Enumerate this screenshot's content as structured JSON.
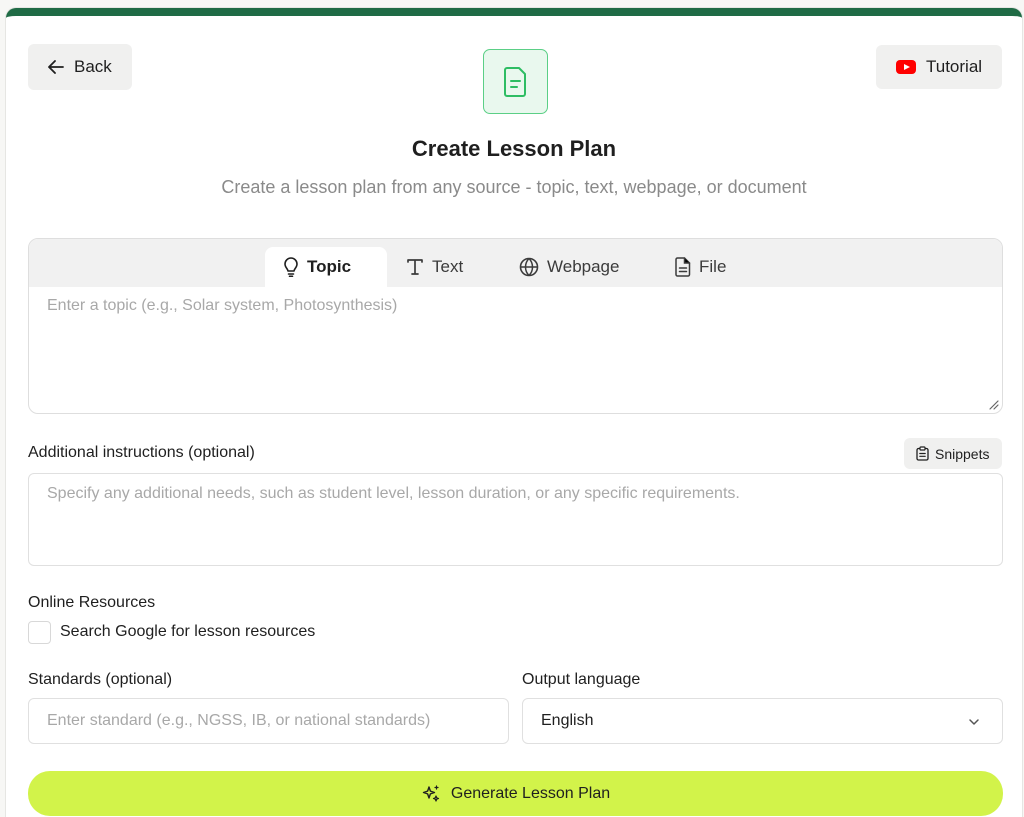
{
  "header": {
    "back_label": "Back",
    "tutorial_label": "Tutorial",
    "title": "Create Lesson Plan",
    "subtitle": "Create a lesson plan from any source - topic, text, webpage, or document"
  },
  "source": {
    "tabs": [
      {
        "label": "Topic",
        "icon": "lightbulb-icon",
        "active": true
      },
      {
        "label": "Text",
        "icon": "text-icon",
        "active": false
      },
      {
        "label": "Webpage",
        "icon": "globe-icon",
        "active": false
      },
      {
        "label": "File",
        "icon": "file-icon",
        "active": false
      }
    ],
    "topic_placeholder": "Enter a topic (e.g., Solar system, Photosynthesis)",
    "topic_value": ""
  },
  "instructions": {
    "label": "Additional instructions (optional)",
    "snippets_label": "Snippets",
    "placeholder": "Specify any additional needs, such as student level, lesson duration, or any specific requirements.",
    "value": ""
  },
  "resources": {
    "label": "Online Resources",
    "checkbox_label": "Search Google for lesson resources",
    "checked": false
  },
  "standards": {
    "label": "Standards (optional)",
    "placeholder": "Enter standard (e.g., NGSS, IB, or national standards)",
    "value": ""
  },
  "language": {
    "label": "Output language",
    "selected": "English"
  },
  "generate_label": "Generate Lesson Plan",
  "colors": {
    "top_bar": "#1f6b45",
    "accent_green": "#5bcf86",
    "generate_bg": "#d2f34a",
    "youtube_red": "#ff0000"
  }
}
